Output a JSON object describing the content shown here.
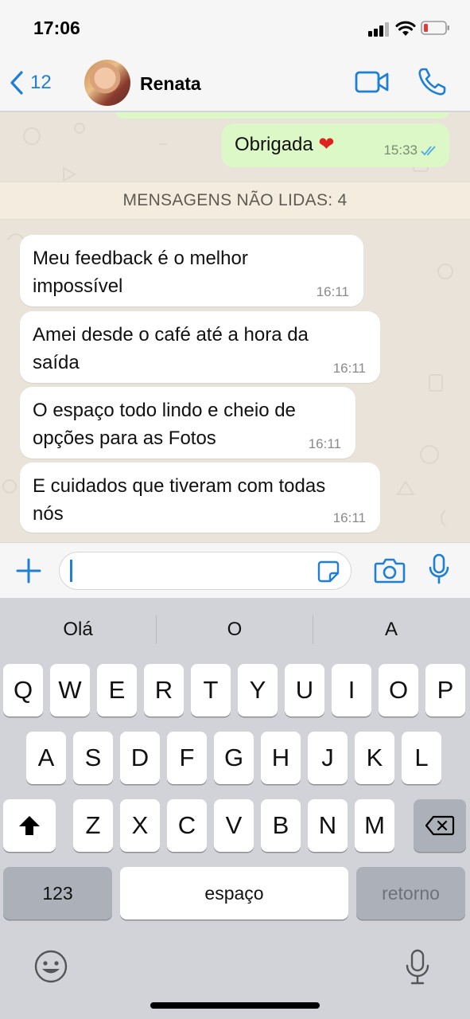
{
  "status": {
    "time": "17:06",
    "battery_color": "#e53935"
  },
  "header": {
    "back_count": "12",
    "contact_name": "Renata",
    "accent": "#1f7fd4"
  },
  "chat": {
    "outgoing": {
      "text": "Obrigada",
      "emoji": "❤️",
      "time": "15:33",
      "status_icon": "double-check-icon"
    },
    "unread_banner": "MENSAGENS NÃO LIDAS: 4",
    "messages": [
      {
        "line1": "Meu feedback é o melhor",
        "line2": "impossível",
        "time": "16:11"
      },
      {
        "line1": "Amei desde o café até a hora da",
        "line2": "saída",
        "time": "16:11"
      },
      {
        "line1": "O espaço todo lindo e cheio de",
        "line2": "opções para as Fotos",
        "time": "16:11"
      },
      {
        "line1": "E cuidados que tiveram com todas",
        "line2": "nós",
        "time": "16:11"
      }
    ]
  },
  "input": {
    "value": ""
  },
  "keyboard": {
    "suggestions": [
      "Olá",
      "O",
      "A"
    ],
    "row1": [
      "Q",
      "W",
      "E",
      "R",
      "T",
      "Y",
      "U",
      "I",
      "O",
      "P"
    ],
    "row2": [
      "A",
      "S",
      "D",
      "F",
      "G",
      "H",
      "J",
      "K",
      "L"
    ],
    "row3": [
      "Z",
      "X",
      "C",
      "V",
      "B",
      "N",
      "M"
    ],
    "numbers_label": "123",
    "space_label": "espaço",
    "return_label": "retorno"
  }
}
